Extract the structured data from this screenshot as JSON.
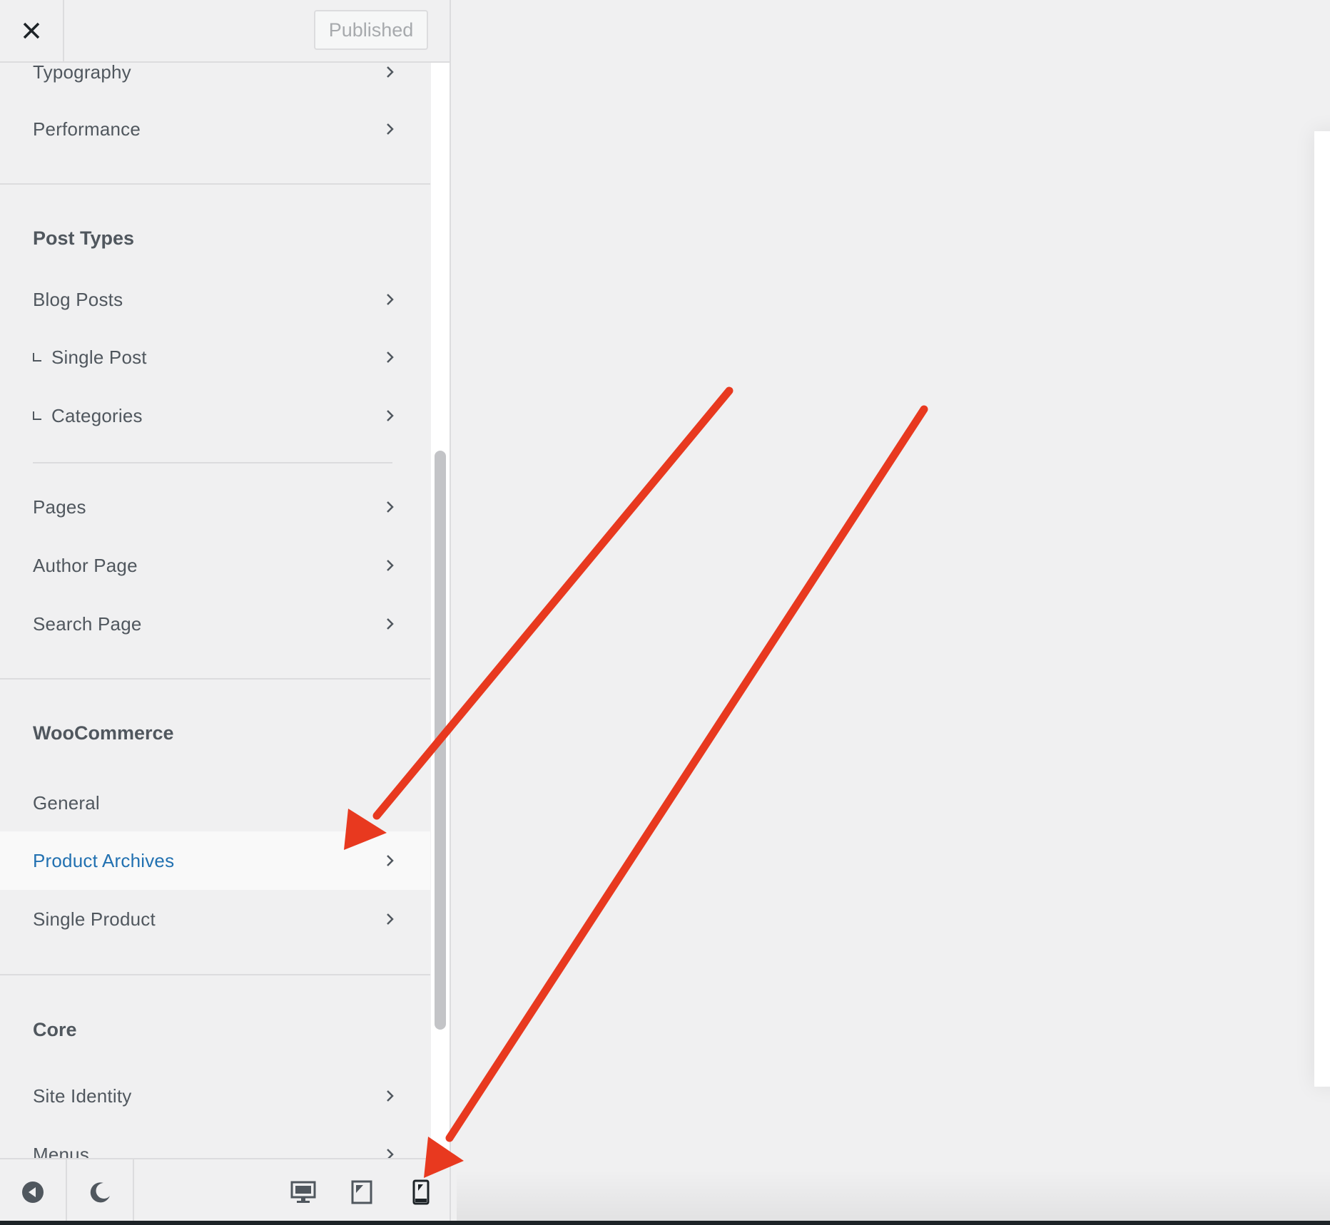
{
  "header": {
    "close_icon": "close-icon",
    "publish_label": "Published"
  },
  "menu": {
    "top_items": [
      {
        "label": "Typography"
      },
      {
        "label": "Performance"
      }
    ],
    "post_types": {
      "title": "Post Types",
      "items": [
        {
          "label": "Blog Posts"
        },
        {
          "label": "Single Post"
        },
        {
          "label": "Categories"
        },
        {
          "label": "Pages"
        },
        {
          "label": "Author Page"
        },
        {
          "label": "Search Page"
        }
      ]
    },
    "woocommerce": {
      "title": "WooCommerce",
      "items": [
        {
          "label": "General"
        },
        {
          "label": "Product Archives",
          "active": true
        },
        {
          "label": "Single Product"
        }
      ]
    },
    "core": {
      "title": "Core",
      "items": [
        {
          "label": "Site Identity"
        },
        {
          "label": "Menus"
        }
      ]
    }
  },
  "footer": {
    "collapse_icon": "collapse-icon",
    "dark_mode_icon": "moon-icon",
    "devices": [
      {
        "name": "desktop-icon"
      },
      {
        "name": "tablet-icon"
      },
      {
        "name": "mobile-icon",
        "active": true
      }
    ]
  },
  "colors": {
    "accent": "#2271b1",
    "annotation_arrow": "#e8391f",
    "sidebar_bg": "#f0f0f1",
    "text": "#50575e"
  }
}
